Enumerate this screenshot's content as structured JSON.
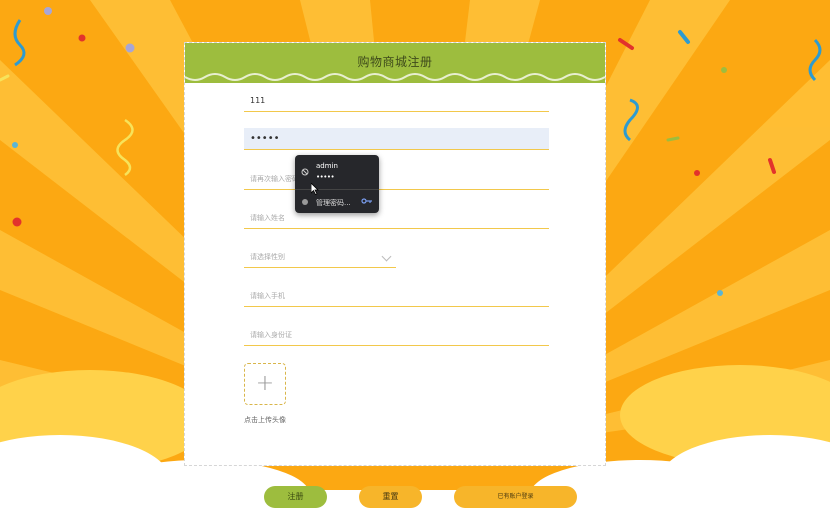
{
  "form": {
    "title": "购物商城注册",
    "username_value": "111",
    "password_value": "•••••",
    "confirm_password_placeholder": "请再次输入密码",
    "name_placeholder": "请输入姓名",
    "gender_placeholder": "请选择性别",
    "phone_placeholder": "请输入手机",
    "idcard_placeholder": "请输入身份证",
    "upload_plus": "+",
    "upload_hint": "点击上传头像"
  },
  "autofill_popup": {
    "username": "admin",
    "password_mask": "•••••",
    "manage_label": "管理密码..."
  },
  "buttons": {
    "register": "注册",
    "reset": "重置",
    "login": "已有账户登录"
  },
  "colors": {
    "background": "#fbab12",
    "header": "#9dbd3e",
    "accent": "#f7b52a"
  }
}
